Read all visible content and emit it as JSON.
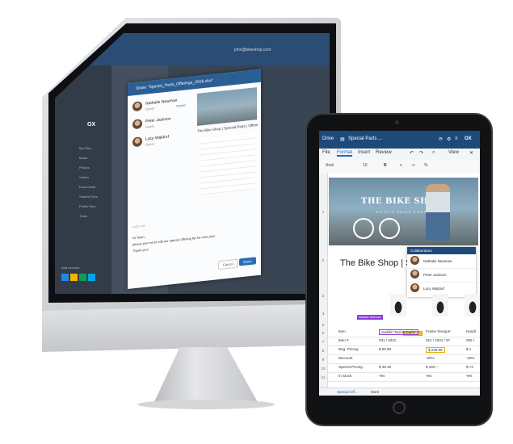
{
  "desktop": {
    "brand": "OX",
    "user_email": "john@bikeshop.com",
    "sidebar_items": [
      "My Files",
      "Music",
      "Photos",
      "Videos",
      "Documents",
      "Shared Files",
      "Public Files",
      "Trash"
    ],
    "share_dialog": {
      "title": "Share \"Special_Parts_Offerings_2016.xlsx\"",
      "people": [
        {
          "name": "Nathalie Newman",
          "role": "Guest",
          "permission": "Viewer"
        },
        {
          "name": "Peter Jackson",
          "role": "Guest",
          "permission": ""
        },
        {
          "name": "Lucy Waldorf",
          "role": "Guest",
          "permission": ""
        }
      ],
      "preview_title": "The Bike Shop | Special Parts | Offerings",
      "message_placeholder": "Add note",
      "message_lines": [
        "Hi Team,",
        "please join me to edit our special offering list for next year.",
        "Thank you!"
      ],
      "cancel_label": "Cancel",
      "share_label": "Share"
    },
    "add_account_label": "Add Account"
  },
  "tablet": {
    "topbar": {
      "app": "Drive",
      "doc_title": "Special Parts ...",
      "brand": "OX"
    },
    "tabs": [
      {
        "label": "File",
        "active": false
      },
      {
        "label": "Format",
        "active": true
      },
      {
        "label": "Insert",
        "active": false
      },
      {
        "label": "Review",
        "active": false
      }
    ],
    "toolbar": {
      "font": "Arial",
      "size": "10",
      "bold": "B",
      "percent": "%",
      "view": "View"
    },
    "photo_logo": "THE BIKE SHOP",
    "photo_sub": "BICYCLE SALES & REPAIRS",
    "sheet_title": "The Bike Shop | Sp",
    "collaborators": {
      "title": "Collaborators",
      "people": [
        "Nathalie Newman",
        "Peter Jackson",
        "Lucy Waldorf"
      ]
    },
    "row_numbers": [
      "1",
      "2",
      "3",
      "4",
      "5",
      "6",
      "7",
      "8",
      "9",
      "10",
      "11"
    ],
    "badges": {
      "nathalie": "Nathalie Newman",
      "lucy": "Lucy Waldorf"
    },
    "table": [
      {
        "label": "Item",
        "c1": "Saddle \"Monte Carlo\"",
        "c2": "Frame 'Eveque'",
        "c3": "Handl"
      },
      {
        "label": "Item #",
        "c1": "031 / 4031",
        "c2": "012 / 4031 / 97",
        "c3": "005 /"
      },
      {
        "label": "Reg. Pricing",
        "c1": "$   59.99",
        "c2": "$  239.99",
        "c3": "$  1"
      },
      {
        "label": "Discount",
        "c1": "",
        "c2": "-20%",
        "c3": "-20%"
      },
      {
        "label": "Special Pricing",
        "c1": "$   46.19",
        "c2": "$  192.--",
        "c3": "$  74"
      },
      {
        "label": "In Stock",
        "c1": "Yes",
        "c2": "Yes",
        "c3": "Yes"
      }
    ],
    "sheet_tab": "Special Off...",
    "more_label": "More"
  }
}
